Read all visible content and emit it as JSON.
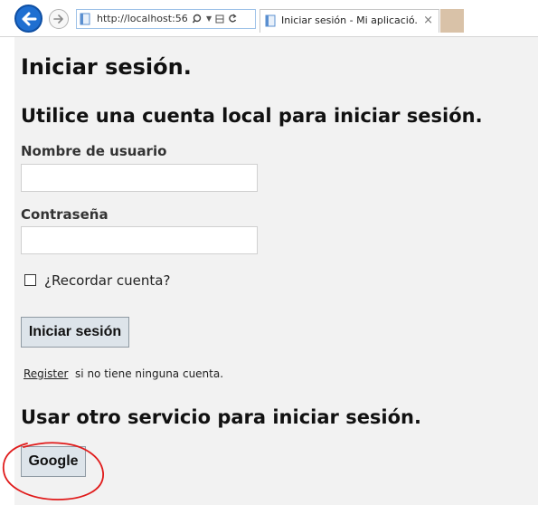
{
  "browser": {
    "url": "http://localhost:56",
    "tab_title": "Iniciar sesión - Mi aplicació...",
    "tab_close": "×"
  },
  "page": {
    "title": "Iniciar sesión.",
    "local_heading": "Utilice una cuenta local para iniciar sesión.",
    "username_label": "Nombre de usuario",
    "username_value": "",
    "password_label": "Contraseña",
    "password_value": "",
    "remember_label": "¿Recordar cuenta?",
    "login_button": "Iniciar sesión",
    "register_link": "Register",
    "register_suffix": "si no tiene ninguna cuenta.",
    "external_heading": "Usar otro servicio para iniciar sesión.",
    "google_button": "Google"
  },
  "colors": {
    "back_button": "#1f6fd1",
    "annotation_circle": "#e01b1b"
  }
}
